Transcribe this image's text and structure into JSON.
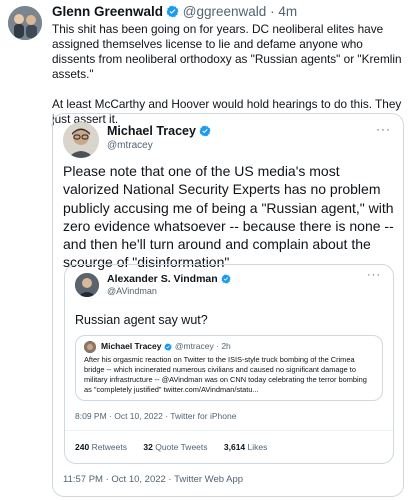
{
  "outer_tweet": {
    "author_name": "Glenn Greenwald",
    "handle": "@ggreenwald",
    "separator": "·",
    "age": "4m",
    "paragraphs": [
      "This shit has been going on for years. DC neoliberal elites have assigned themselves license to lie and defame anyone who dissents from neoliberal orthodoxy as \"Russian agents\" or \"Kremlin assets.\"",
      "At least McCarthy and Hoover would hold hearings to do this. They just assert it."
    ]
  },
  "quoted_tweet": {
    "author_name": "Michael Tracey",
    "handle": "@mtracey",
    "more": "···",
    "text": "Please note that one of the US media's most valorized National Security Experts has no problem publicly accusing me of being a \"Russian agent,\" with zero evidence whatsoever -- because there is none -- and then he'll turn around and complain about the scourge of \"disinformation\"",
    "timestamp": "11:57 PM · Oct 10, 2022 · Twitter Web App"
  },
  "nested_tweet": {
    "author_name": "Alexander S. Vindman",
    "handle": "@AVindman",
    "more": "···",
    "text": "Russian agent say wut?",
    "timestamp": "8:09 PM · Oct 10, 2022 · Twitter for iPhone",
    "stats": {
      "retweets_count": "240",
      "retweets_label": "Retweets",
      "quotes_count": "32",
      "quotes_label": "Quote Tweets",
      "likes_count": "3,614",
      "likes_label": "Likes"
    }
  },
  "inner_quote": {
    "author_name": "Michael Tracey",
    "handle": "@mtracey",
    "separator": "·",
    "age": "2h",
    "text": "After his orgasmic reaction on Twitter to the ISIS-style truck bombing of the Crimea bridge -- which incinerated numerous civilians and caused no significant damage to military infrastructure -- @AVindman was on CNN today celebrating the terror bombing as \"completely justified\" twitter.com/AVindman/statu..."
  },
  "colors": {
    "verified": "#1d9bf0",
    "text": "#0f1419",
    "muted": "#536471",
    "border": "#cfd9de"
  }
}
